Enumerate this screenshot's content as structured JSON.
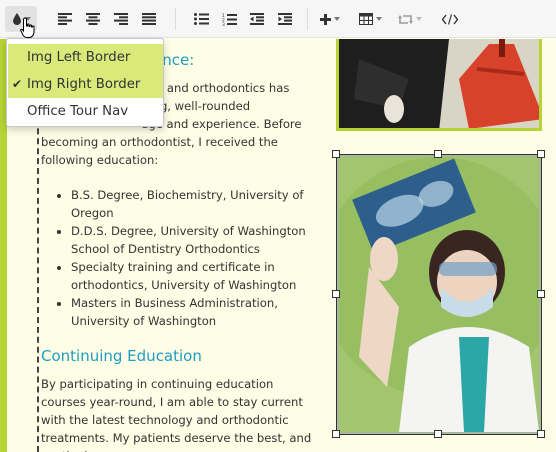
{
  "toolbar": {
    "buttons": [
      "color-style",
      "align-left",
      "align-center",
      "align-right",
      "align-justify",
      "bulleted-list",
      "numbered-list",
      "outdent",
      "indent",
      "insert",
      "table",
      "undo-redo",
      "code-view"
    ]
  },
  "dropdown": {
    "items": [
      {
        "label": "Img Left Border",
        "checked": false,
        "highlighted": true
      },
      {
        "label": "Img Right Border",
        "checked": true,
        "highlighted": true
      },
      {
        "label": "Office Tour Nav",
        "checked": false,
        "highlighted": false
      }
    ],
    "check_glyph": "✔"
  },
  "content": {
    "heading_top_fragment": "ence:",
    "p1_lines": [
      "stry and orthodontics has",
      "rong, well-rounded",
      "dge and experience. Before",
      "becoming an orthodontist, I received the",
      "following education:"
    ],
    "education": [
      "B.S. Degree, Biochemistry, University of Oregon",
      "D.D.S. Degree, University of Washington School of Dentistry Orthodontics",
      "Specialty training and certificate in orthodontics, University of Washington",
      "Masters in Business Administration, University of Washington"
    ],
    "heading_continuing": "Continuing Education",
    "p2": "By participating in continuing education courses year-round, I am able to stay current with the latest technology and orthodontic treatments. My patients deserve the best, and continuing"
  },
  "colors": {
    "accent_green": "#b7d436",
    "heading_blue": "#1f9cc4",
    "editor_bg": "#fefde6",
    "menu_highlight": "#d9ea7b"
  }
}
